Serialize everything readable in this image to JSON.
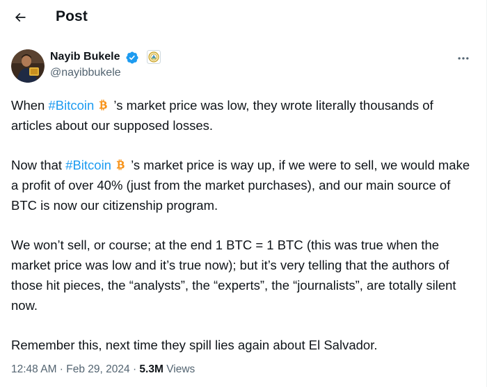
{
  "header": {
    "title": "Post",
    "back_icon": "arrow-left-icon"
  },
  "author": {
    "name": "Nayib Bukele",
    "handle": "@nayibbukele",
    "verified_icon": "verified-badge-icon",
    "affiliate_icon": "government-seal-icon",
    "more_icon": "more-dots-icon"
  },
  "tweet": {
    "p1_before": "When ",
    "p1_hashtag": "#Bitcoin",
    "p1_after": " ’s market price was low, they wrote literally thousands of articles about our supposed losses.",
    "p2_before": "Now that ",
    "p2_hashtag": "#Bitcoin",
    "p2_after": " ’s market price is way up, if we were to sell, we would make a profit of over 40% (just from the market purchases), and our main source of BTC is now our citizenship program.",
    "p3": "We won’t sell, or course; at the end 1 BTC = 1 BTC (this was true when the market price was low and it’s true now); but it’s very telling that the authors of those hit pieces, the “analysts”, the “experts”, the “journalists”, are totally silent now.",
    "p4": "Remember this, next time they spill lies again about El Salvador."
  },
  "meta": {
    "time": "12:48 AM",
    "sep1": " · ",
    "date": "Feb 29, 2024",
    "sep2": " · ",
    "views_count": "5.3M",
    "views_label": " Views"
  },
  "colors": {
    "text": "#0f1419",
    "secondary": "#536471",
    "link": "#1d9bf0",
    "verified": "#1d9bf0",
    "bitcoin": "#f7931a"
  }
}
